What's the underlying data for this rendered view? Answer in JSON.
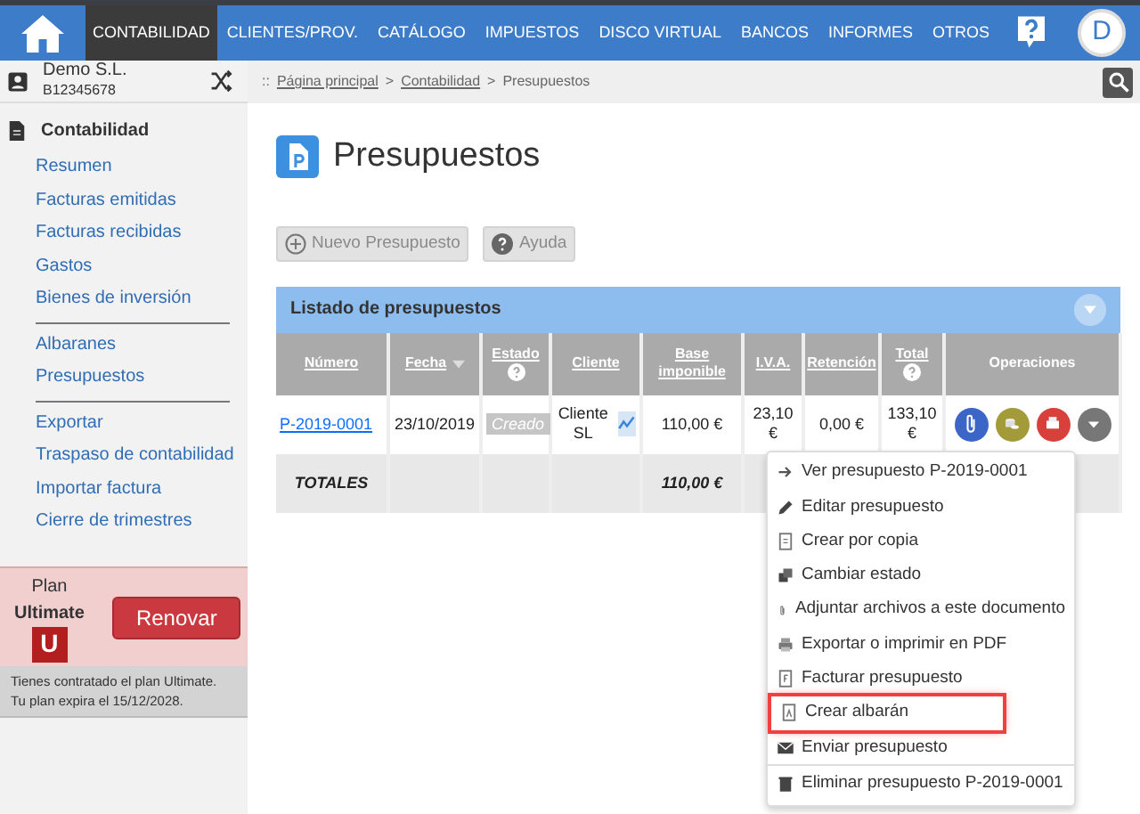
{
  "topnav": {
    "items": [
      {
        "label": "CONTABILIDAD",
        "selected": true
      },
      {
        "label": "CLIENTES/PROV.",
        "selected": false
      },
      {
        "label": "CATÁLOGO",
        "selected": false
      },
      {
        "label": "IMPUESTOS",
        "selected": false
      },
      {
        "label": "DISCO VIRTUAL",
        "selected": false
      },
      {
        "label": "BANCOS",
        "selected": false
      },
      {
        "label": "INFORMES",
        "selected": false
      },
      {
        "label": "OTROS",
        "selected": false
      }
    ],
    "user_initial": "D"
  },
  "company": {
    "name": "Demo S.L.",
    "tax_id": "B12345678"
  },
  "breadcrumb": {
    "prefix": "::",
    "links": [
      "Página principal",
      "Contabilidad"
    ],
    "separator": ">",
    "current": "Presupuestos"
  },
  "sidebar": {
    "section": "Contabilidad",
    "groups": [
      [
        "Resumen",
        "Facturas emitidas",
        "Facturas recibidas",
        "Gastos",
        "Bienes de inversión"
      ],
      [
        "Albaranes",
        "Presupuestos"
      ],
      [
        "Exportar",
        "Traspaso de contabilidad",
        "Importar factura",
        "Cierre de trimestres"
      ]
    ]
  },
  "plan": {
    "label": "Plan",
    "name": "Ultimate",
    "badge": "U",
    "button": "Renovar",
    "note": [
      "Tienes contratado el plan Ultimate.",
      "Tu plan expira el 15/12/2028."
    ]
  },
  "page": {
    "title": "Presupuestos",
    "buttons": [
      "Nuevo Presupuesto",
      "Ayuda"
    ]
  },
  "table": {
    "title": "Listado de presupuestos",
    "columns": [
      {
        "label": "Número",
        "help": false,
        "sorted": false
      },
      {
        "label": "Fecha",
        "help": false,
        "sorted": true
      },
      {
        "label": "Estado",
        "help": true,
        "sorted": false
      },
      {
        "label": "Cliente",
        "help": false,
        "sorted": false
      },
      {
        "label": "Base imponible",
        "help": false,
        "sorted": false
      },
      {
        "label": "I.V.A.",
        "help": false,
        "sorted": false
      },
      {
        "label": "Retención",
        "help": false,
        "sorted": false
      },
      {
        "label": "Total",
        "help": true,
        "sorted": false
      },
      {
        "label": "Operaciones",
        "help": false,
        "sorted": false
      }
    ],
    "rows": [
      {
        "number": "P-2019-0001",
        "date": "23/10/2019",
        "status": "Creado",
        "client": "Cliente SL",
        "base": "110,00 €",
        "vat": "23,10 €",
        "withholding": "0,00 €",
        "total": "133,10 €"
      }
    ],
    "totals": {
      "label": "TOTALES",
      "base": "110,00 €"
    }
  },
  "menu": {
    "items": [
      {
        "label": "Ver presupuesto P-2019-0001",
        "highlighted": false,
        "divider_before": false
      },
      {
        "label": "Editar presupuesto",
        "highlighted": false,
        "divider_before": false
      },
      {
        "label": "Crear por copia",
        "highlighted": false,
        "divider_before": false
      },
      {
        "label": "Cambiar estado",
        "highlighted": false,
        "divider_before": false
      },
      {
        "label": "Adjuntar archivos a este documento",
        "highlighted": false,
        "divider_before": false
      },
      {
        "label": "Exportar o imprimir en PDF",
        "highlighted": false,
        "divider_before": false
      },
      {
        "label": "Facturar presupuesto",
        "highlighted": false,
        "divider_before": false
      },
      {
        "label": "Crear albarán",
        "highlighted": true,
        "divider_before": false
      },
      {
        "label": "Enviar presupuesto",
        "highlighted": false,
        "divider_before": false
      },
      {
        "label": "Eliminar presupuesto P-2019-0001",
        "highlighted": false,
        "divider_before": true
      }
    ]
  }
}
